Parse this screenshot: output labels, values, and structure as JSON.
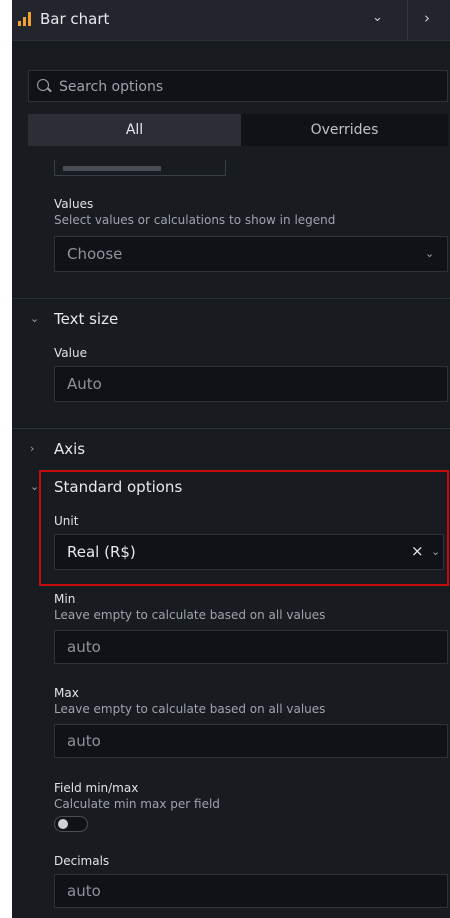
{
  "header": {
    "title": "Bar chart",
    "icon": "bar-chart-icon",
    "accent": "#f2a12c"
  },
  "search": {
    "placeholder": "Search options"
  },
  "tabs": [
    {
      "label": "All",
      "active": true
    },
    {
      "label": "Overrides",
      "active": false
    }
  ],
  "legend": {
    "values": {
      "label": "Values",
      "description": "Select values or calculations to show in legend",
      "placeholder": "Choose"
    }
  },
  "text_size": {
    "title": "Text size",
    "value": {
      "label": "Value",
      "placeholder": "Auto"
    }
  },
  "axis": {
    "title": "Axis"
  },
  "standard_options": {
    "title": "Standard options",
    "unit": {
      "label": "Unit",
      "value": "Real (R$)"
    },
    "min": {
      "label": "Min",
      "description": "Leave empty to calculate based on all values",
      "placeholder": "auto"
    },
    "max": {
      "label": "Max",
      "description": "Leave empty to calculate based on all values",
      "placeholder": "auto"
    },
    "field_minmax": {
      "label": "Field min/max",
      "description": "Calculate min max per field",
      "enabled": false
    },
    "decimals": {
      "label": "Decimals",
      "placeholder": "auto"
    }
  },
  "highlight_color": "#c50d0d"
}
